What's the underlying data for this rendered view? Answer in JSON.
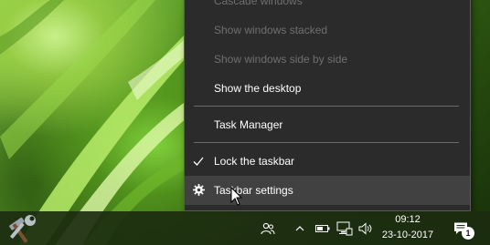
{
  "context_menu": {
    "items": [
      {
        "label": "Cascade windows",
        "enabled": false
      },
      {
        "label": "Show windows stacked",
        "enabled": false
      },
      {
        "label": "Show windows side by side",
        "enabled": false
      },
      {
        "label": "Show the desktop",
        "enabled": true
      },
      {
        "label": "Task Manager",
        "enabled": true
      },
      {
        "label": "Lock the taskbar",
        "enabled": true,
        "checked": true
      },
      {
        "label": "Taskbar settings",
        "enabled": true,
        "hovered": true
      }
    ]
  },
  "taskbar": {
    "start_logo_icon": "hammer-wrench-icon",
    "tray_icons": [
      "people-icon",
      "chevron-up-icon",
      "battery-icon",
      "network-icon",
      "volume-icon"
    ],
    "clock": {
      "time": "09:12",
      "date": "23-10-2017"
    },
    "action_center": {
      "icon": "action-center-icon",
      "badge": "1"
    }
  },
  "colors": {
    "menu_bg": "#2b2b2b",
    "menu_text": "#ffffff",
    "menu_disabled_text": "#6f6f6f",
    "menu_hover": "#414141",
    "taskbar_bg": "#1c2c10"
  }
}
